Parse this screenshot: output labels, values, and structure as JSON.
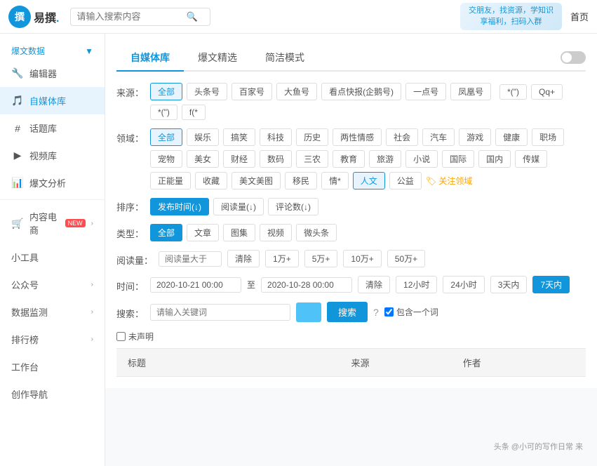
{
  "header": {
    "logo_text": "易撰",
    "logo_char": "撰",
    "search_placeholder": "请输入搜索内容",
    "banner_line1": "交朋友，找资源，学知识",
    "banner_line2": "享福利，扫码入群",
    "nav_home": "首页"
  },
  "sidebar": {
    "section1": {
      "label": "爆文数据",
      "arrow": "▼"
    },
    "items": [
      {
        "id": "editor",
        "icon": "🔧",
        "label": "编辑器",
        "active": false
      },
      {
        "id": "zimeiti",
        "icon": "🎵",
        "label": "自媒体库",
        "active": true
      },
      {
        "id": "topic",
        "icon": "#",
        "label": "话题库",
        "active": false
      },
      {
        "id": "video",
        "icon": "▶",
        "label": "视频库",
        "active": false
      },
      {
        "id": "analysis",
        "icon": "📊",
        "label": "爆文分析",
        "active": false
      },
      {
        "id": "ecommerce",
        "icon": "🛒",
        "label": "内容电商",
        "badge": "NEW",
        "active": false
      },
      {
        "id": "tools",
        "icon": "",
        "label": "小工具",
        "active": false
      },
      {
        "id": "publicaccount",
        "icon": "",
        "label": "公众号",
        "active": false
      },
      {
        "id": "datamonitor",
        "icon": "",
        "label": "数据监测",
        "active": false
      },
      {
        "id": "rankings",
        "icon": "",
        "label": "排行榜",
        "active": false
      },
      {
        "id": "workspace",
        "icon": "",
        "label": "工作台",
        "active": false
      },
      {
        "id": "creation",
        "icon": "",
        "label": "创作导航",
        "active": false
      }
    ]
  },
  "tabs": [
    {
      "id": "zimeiti",
      "label": "自媒体库",
      "active": true
    },
    {
      "id": "baowenjingxuan",
      "label": "爆文精选",
      "active": false
    },
    {
      "id": "jianjiemode",
      "label": "简洁模式",
      "active": false
    }
  ],
  "filters": {
    "source_label": "来源：",
    "sources": [
      {
        "id": "all",
        "label": "全部",
        "active": true
      },
      {
        "id": "toutiao",
        "label": "头条号",
        "active": false
      },
      {
        "id": "baijiahao",
        "label": "百家号",
        "active": false
      },
      {
        "id": "dayu",
        "label": "大鱼号",
        "active": false
      },
      {
        "id": "kandian",
        "label": "看点快报(企鹅号)",
        "active": false
      },
      {
        "id": "yidian",
        "label": "一点号",
        "active": false
      },
      {
        "id": "fenghuang",
        "label": "凤凰号",
        "active": false
      },
      {
        "id": "s1",
        "label": "*(\")",
        "active": false
      },
      {
        "id": "s2",
        "label": "Qq+",
        "active": false
      },
      {
        "id": "s3",
        "label": "*(\")",
        "active": false
      },
      {
        "id": "s4",
        "label": "f(*",
        "active": false
      }
    ],
    "domain_label": "领域：",
    "domains": [
      {
        "id": "all",
        "label": "全部",
        "active": true
      },
      {
        "id": "ent",
        "label": "娱乐",
        "active": false
      },
      {
        "id": "funny",
        "label": "搞笑",
        "active": false
      },
      {
        "id": "tech",
        "label": "科技",
        "active": false
      },
      {
        "id": "history",
        "label": "历史",
        "active": false
      },
      {
        "id": "emotion",
        "label": "两性情感",
        "active": false
      },
      {
        "id": "society",
        "label": "社会",
        "active": false
      },
      {
        "id": "car",
        "label": "汽车",
        "active": false
      },
      {
        "id": "game",
        "label": "游戏",
        "active": false
      },
      {
        "id": "health",
        "label": "健康",
        "active": false
      },
      {
        "id": "workplace",
        "label": "职场",
        "active": false
      },
      {
        "id": "pet",
        "label": "宠物",
        "active": false
      },
      {
        "id": "beauty",
        "label": "美女",
        "active": false
      },
      {
        "id": "finance",
        "label": "财经",
        "active": false
      },
      {
        "id": "digital",
        "label": "数码",
        "active": false
      },
      {
        "id": "sannong",
        "label": "三农",
        "active": false
      },
      {
        "id": "education",
        "label": "教育",
        "active": false
      },
      {
        "id": "travel",
        "label": "旅游",
        "active": false
      },
      {
        "id": "xiaoshuo",
        "label": "小说",
        "active": false
      },
      {
        "id": "intl",
        "label": "国际",
        "active": false
      },
      {
        "id": "domestic",
        "label": "国内",
        "active": false
      },
      {
        "id": "media",
        "label": "传媒",
        "active": false
      },
      {
        "id": "positive",
        "label": "正能量",
        "active": false
      },
      {
        "id": "collection",
        "label": "收藏",
        "active": false
      },
      {
        "id": "design",
        "label": "美文美图",
        "active": false
      },
      {
        "id": "immigrant",
        "label": "移民",
        "active": false
      },
      {
        "id": "other",
        "label": "情*",
        "active": false
      },
      {
        "id": "renwen",
        "label": "人文",
        "active": false
      },
      {
        "id": "gongyi",
        "label": "公益",
        "active": false
      }
    ],
    "domain_link": "🏷 关注领域",
    "sort_label": "排序：",
    "sorts": [
      {
        "id": "time",
        "label": "发布时间(↓)",
        "active": true
      },
      {
        "id": "read",
        "label": "阅读量(↓)",
        "active": false
      },
      {
        "id": "comment",
        "label": "评论数(↓)",
        "active": false
      }
    ],
    "type_label": "类型：",
    "types": [
      {
        "id": "all",
        "label": "全部",
        "active": true
      },
      {
        "id": "article",
        "label": "文章",
        "active": false
      },
      {
        "id": "gallery",
        "label": "图集",
        "active": false
      },
      {
        "id": "video",
        "label": "视频",
        "active": false
      },
      {
        "id": "microhead",
        "label": "微头条",
        "active": false
      }
    ],
    "read_label": "阅读量：",
    "read_placeholder": "阅读量大于",
    "read_options": [
      {
        "id": "clear",
        "label": "清除"
      },
      {
        "id": "1w",
        "label": "1万+"
      },
      {
        "id": "5w",
        "label": "5万+"
      },
      {
        "id": "10w",
        "label": "10万+"
      },
      {
        "id": "50w",
        "label": "50万+"
      }
    ],
    "time_label": "时间：",
    "time_from": "2020-10-21 00:00",
    "time_sep": "至",
    "time_to": "2020-10-28 00:00",
    "time_options": [
      {
        "id": "clear",
        "label": "清除"
      },
      {
        "id": "12h",
        "label": "12小时"
      },
      {
        "id": "24h",
        "label": "24小时"
      },
      {
        "id": "3d",
        "label": "3天内"
      },
      {
        "id": "7d",
        "label": "7天内",
        "active": true
      }
    ],
    "search_label": "搜索：",
    "keyword_placeholder": "请输入关键词",
    "search_btn": "搜索",
    "undeclared": "未声明",
    "include_label": "包含一个词"
  },
  "table": {
    "cols": [
      {
        "id": "title",
        "label": "标题"
      },
      {
        "id": "source",
        "label": "来源"
      },
      {
        "id": "author",
        "label": "作者"
      }
    ]
  },
  "watermark": "头条 @小可的写作日常 来"
}
